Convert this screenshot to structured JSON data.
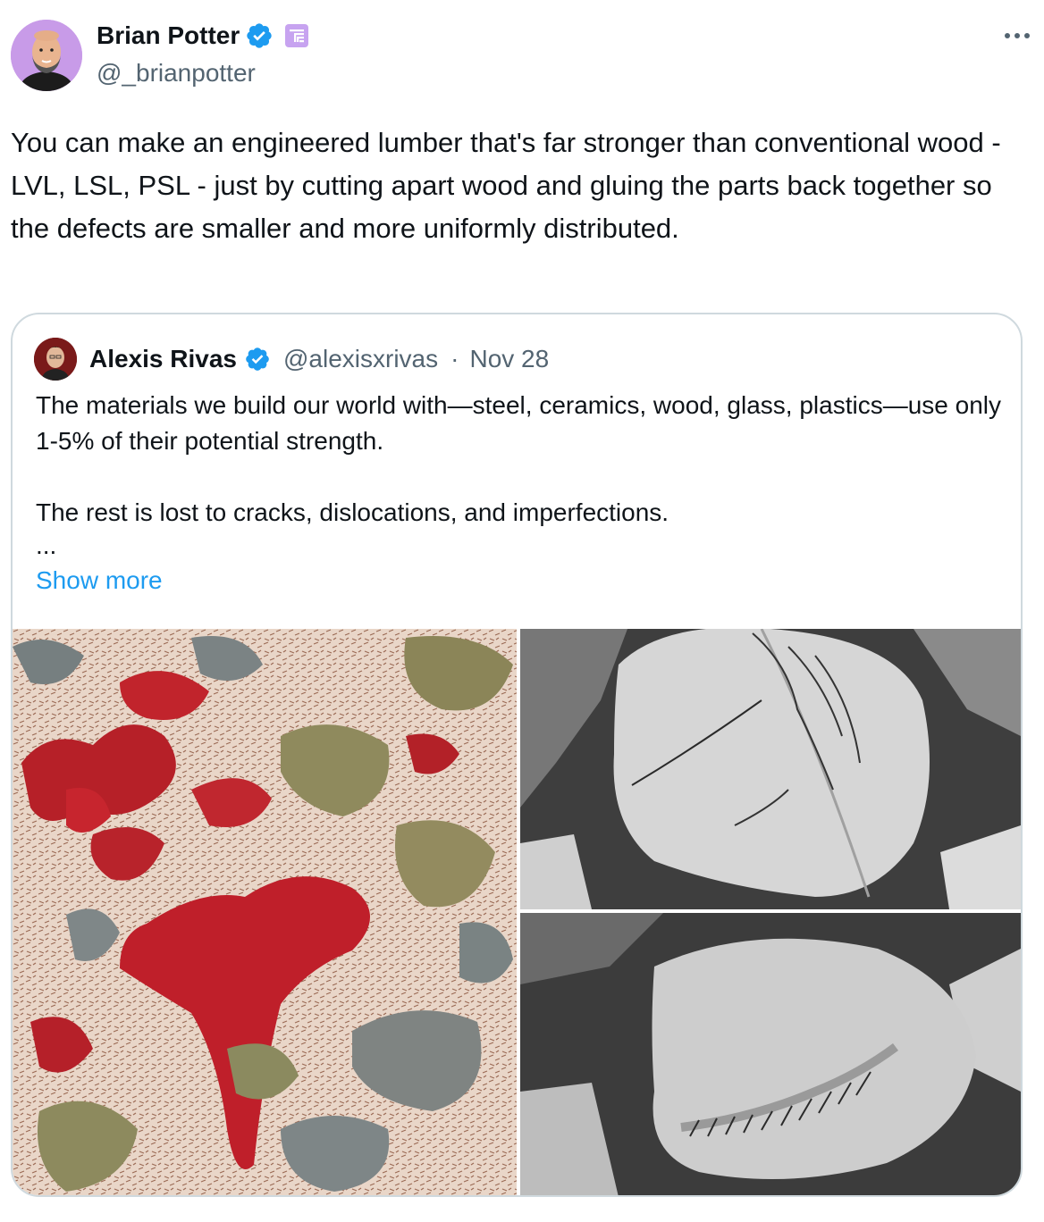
{
  "author": {
    "display_name": "Brian Potter",
    "handle": "@_brianpotter",
    "avatar_icon": "avatar-brian-potter",
    "verified_icon": "verified-badge-icon",
    "affiliation_icon": "affiliate-badge-icon",
    "avatar_bg": "#c89be8"
  },
  "more_icon": "more-horizontal-icon",
  "tweet": {
    "text": "You can make an engineered lumber that's far stronger than conventional wood - LVL, LSL, PSL - just by cutting apart wood and gluing the parts back together so the defects are smaller and more uniformly distributed."
  },
  "quote": {
    "display_name": "Alexis Rivas",
    "handle": "@alexisxrivas",
    "separator": "·",
    "date": "Nov 28",
    "text_line1": "The materials we build our world with—steel, ceramics, wood, glass, plastics—use only 1-5% of their potential strength.",
    "text_line2": "The rest is lost to cracks, dislocations, and imperfections.",
    "ellipsis": "...",
    "show_more": "Show more",
    "link_color": "#1d9bf0",
    "images": [
      {
        "icon": "micrograph-colored-image"
      },
      {
        "icon": "crystal-dislocations-image-1"
      },
      {
        "icon": "crystal-dislocations-image-2"
      }
    ]
  },
  "colors": {
    "text": "#0f1419",
    "secondary": "#536471",
    "border": "#cfd9de",
    "verified": "#1d9bf0",
    "affiliation": "#a97be0"
  }
}
